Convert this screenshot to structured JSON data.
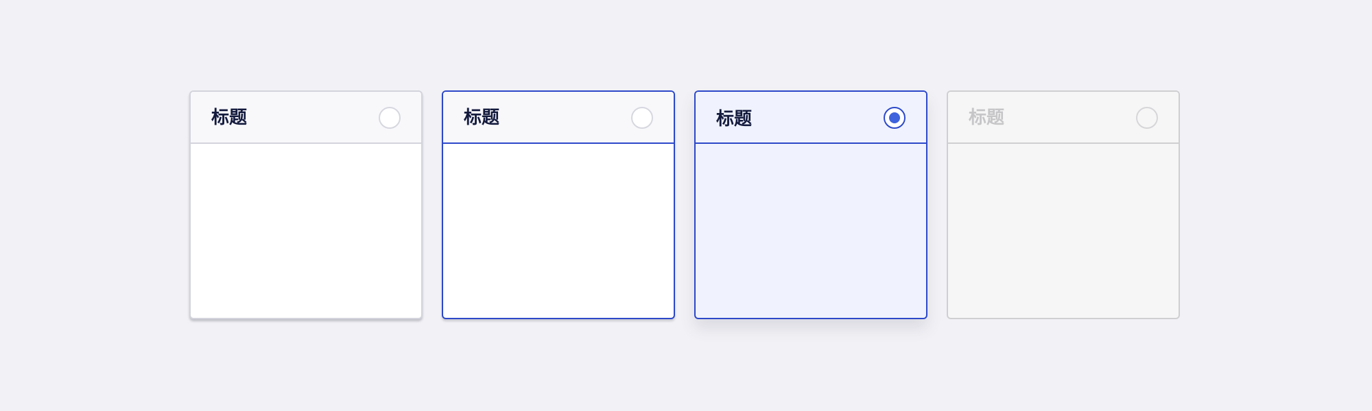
{
  "colors": {
    "page_background": "#f2f2f6",
    "accent": "#2c48c9",
    "radio_selected_fill": "#3e63dd",
    "selected_background": "#f0f3fd",
    "disabled_background": "#f6f6f6"
  },
  "cards": [
    {
      "state": "default",
      "title": "标题",
      "radio_selected": false
    },
    {
      "state": "hover",
      "title": "标题",
      "radio_selected": false
    },
    {
      "state": "selected",
      "title": "标题",
      "radio_selected": true
    },
    {
      "state": "disabled",
      "title": "标题",
      "radio_selected": false
    }
  ]
}
